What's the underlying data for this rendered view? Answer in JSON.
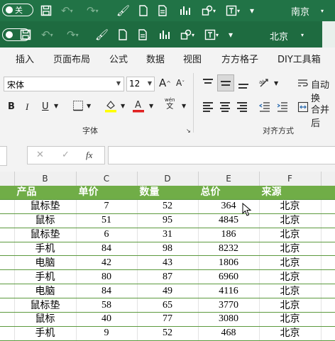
{
  "qat_top": {
    "toggle_label": "关",
    "location": "南京"
  },
  "qat_second": {
    "location": "北京"
  },
  "menu": [
    "插入",
    "页面布局",
    "公式",
    "数据",
    "视图",
    "方方格子",
    "DIY工具箱"
  ],
  "ribbon": {
    "font_name": "宋体",
    "font_size": "12",
    "grow_font": "A",
    "shrink_font": "A",
    "bold": "B",
    "italic": "I",
    "underline": "U",
    "wen_label": "wén",
    "wen_char": "文",
    "font_group_label": "字体",
    "align_group_label": "对齐方式",
    "wrap_label": "自动换",
    "merge_label": "合并后"
  },
  "formula_bar": {
    "fx": "fx",
    "cancel": "✕",
    "confirm": "✓",
    "value": ""
  },
  "columns": [
    "B",
    "C",
    "D",
    "E",
    "F"
  ],
  "table": {
    "headers": [
      "产品",
      "单价",
      "数量",
      "总价",
      "来源"
    ],
    "rows": [
      [
        "鼠标垫",
        "7",
        "52",
        "364",
        "北京"
      ],
      [
        "鼠标",
        "51",
        "95",
        "4845",
        "北京"
      ],
      [
        "鼠标垫",
        "6",
        "31",
        "186",
        "北京"
      ],
      [
        "手机",
        "84",
        "98",
        "8232",
        "北京"
      ],
      [
        "电脑",
        "42",
        "43",
        "1806",
        "北京"
      ],
      [
        "手机",
        "80",
        "87",
        "6960",
        "北京"
      ],
      [
        "电脑",
        "84",
        "49",
        "4116",
        "北京"
      ],
      [
        "鼠标垫",
        "58",
        "65",
        "3770",
        "北京"
      ],
      [
        "鼠标",
        "40",
        "77",
        "3080",
        "北京"
      ],
      [
        "手机",
        "9",
        "52",
        "468",
        "北京"
      ]
    ]
  },
  "colors": {
    "qat_bg": "#217346",
    "header_fill": "#70ad47",
    "row_border": "#5c9a3e"
  }
}
